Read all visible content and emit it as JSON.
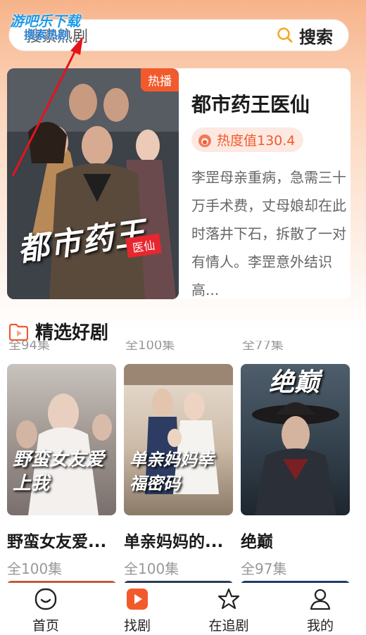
{
  "watermark": {
    "line1": "游吧乐下载",
    "line2": "搜索热剧"
  },
  "search": {
    "placeholder": "搜索热剧",
    "button_label": "搜索"
  },
  "featured": {
    "badge": "热播",
    "poster_title": "都市药王",
    "poster_subtitle": "医仙",
    "title": "都市药王医仙",
    "heat": "热度值130.4",
    "description": "李罡母亲重病，急需三十万手术费，丈母娘却在此时落井下石，拆散了一对有情人。李罡意外结识高..."
  },
  "section": {
    "title": "精选好剧"
  },
  "strip": [
    "全94集",
    "全100集",
    "全77集"
  ],
  "cards": [
    {
      "poster_text": "野蛮女友爱上我",
      "title": "野蛮女友爱...",
      "episodes": "全100集"
    },
    {
      "poster_text": "单亲妈妈幸福密码",
      "title": "单亲妈妈的...",
      "episodes": "全100集"
    },
    {
      "poster_text": "绝巅",
      "title": "绝巅",
      "episodes": "全97集"
    }
  ],
  "tabs": [
    {
      "label": "首页",
      "icon": "home-icon"
    },
    {
      "label": "找剧",
      "icon": "play-icon",
      "active": true
    },
    {
      "label": "在追剧",
      "icon": "star-icon"
    },
    {
      "label": "我的",
      "icon": "user-icon"
    }
  ],
  "colors": {
    "accent": "#f25a2c",
    "gradient_top": "#f7b38a"
  }
}
